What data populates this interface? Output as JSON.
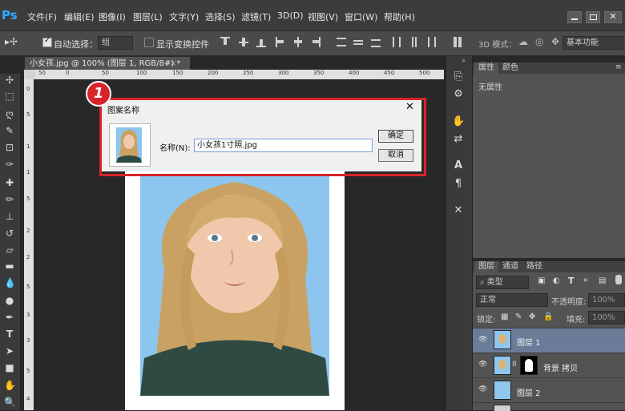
{
  "app": {
    "logo": "Ps"
  },
  "menu": [
    "文件(F)",
    "编辑(E)",
    "图像(I)",
    "图层(L)",
    "文字(Y)",
    "选择(S)",
    "滤镜(T)",
    "3D(D)",
    "视图(V)",
    "窗口(W)",
    "帮助(H)"
  ],
  "options": {
    "auto_select_label": "自动选择：",
    "auto_select_value": "组",
    "show_transform_label": "显示变换控件",
    "mode_3d_label": "3D 模式：",
    "workspace_value": "基本功能"
  },
  "document": {
    "tab_title": "小女孩.jpg @ 100% (图层 1, RGB/8#) *",
    "close_glyph": "×",
    "ruler_h": [
      "50",
      "0",
      "50",
      "100",
      "150",
      "200",
      "250",
      "300",
      "350",
      "400",
      "450",
      "500"
    ],
    "ruler_v": [
      "0",
      "5",
      "1",
      "1",
      "5",
      "2",
      "2",
      "5",
      "3",
      "3",
      "5",
      "4"
    ]
  },
  "dialog": {
    "title": "图案名称",
    "close_glyph": "✕",
    "name_label": "名称(N):",
    "name_value": "小女孩1寸照.jpg",
    "ok_label": "确定",
    "cancel_label": "取消",
    "step_badge": "1",
    "highlight_color": "#d8232a"
  },
  "properties_panel": {
    "tabs": [
      "属性",
      "颜色"
    ],
    "empty_text": "无属性"
  },
  "layers_panel": {
    "tabs": [
      "图层",
      "通道",
      "路径"
    ],
    "filter_value": "类型",
    "blend_mode": "正常",
    "opacity_label": "不透明度:",
    "opacity_value": "100%",
    "lock_label": "锁定:",
    "fill_label": "填充:",
    "fill_value": "100%",
    "layers": [
      {
        "name": "图层 1",
        "selected": true
      },
      {
        "name": "背景 拷贝",
        "selected": false
      },
      {
        "name": "图层 2",
        "selected": false
      }
    ]
  },
  "colors": {
    "accent": "#31a8ff",
    "highlight": "#d8232a",
    "selected_layer": "#6a7c98"
  }
}
